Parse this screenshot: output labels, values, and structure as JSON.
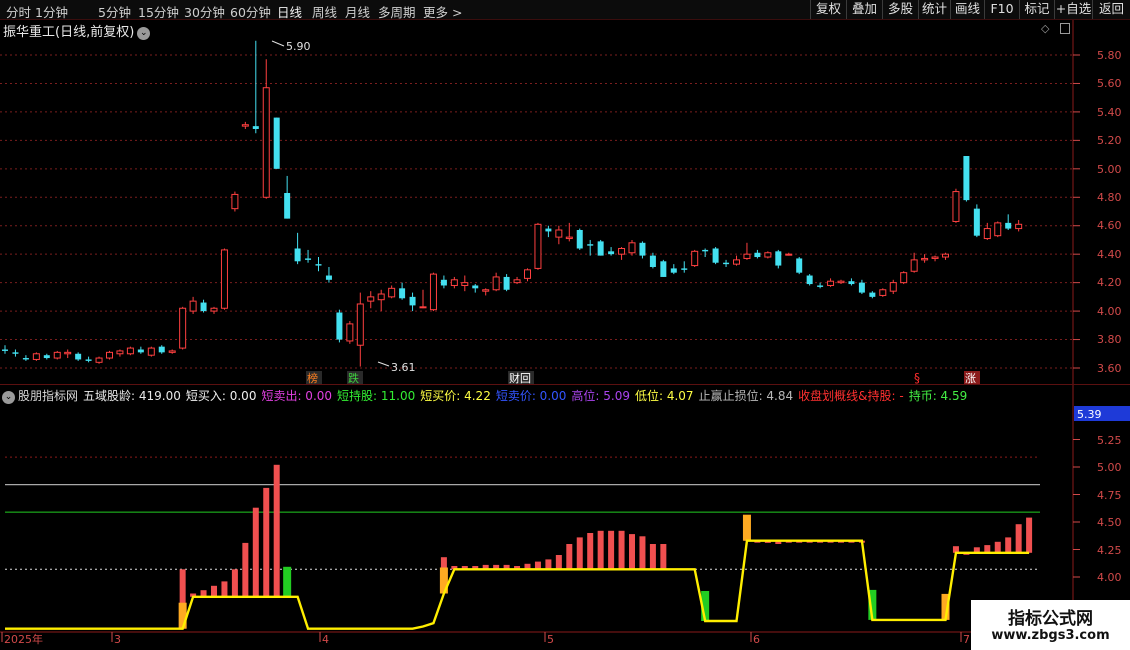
{
  "toolbar": {
    "periods": [
      "分时",
      "1分钟",
      "5分钟",
      "15分钟",
      "30分钟",
      "60分钟",
      "日线",
      "周线",
      "月线",
      "多周期",
      "更多"
    ],
    "more_icon": "chevron-right-icon",
    "right_buttons": [
      "复权",
      "叠加",
      "多股",
      "统计",
      "画线",
      "F10",
      "标记",
      "+自选",
      "返回"
    ]
  },
  "chart_title": "振华重工(日线,前复权)",
  "title_icon": "chevron-down-icon",
  "top_right_icons": [
    "diamond-icon",
    "window-icon"
  ],
  "price_axis": [
    "5.80",
    "5.60",
    "5.40",
    "5.20",
    "5.00",
    "4.80",
    "4.60",
    "4.40",
    "4.20",
    "4.00",
    "3.80",
    "3.60"
  ],
  "annotations": {
    "high": "5.90",
    "low": "3.61"
  },
  "event_markers": [
    {
      "text": "榜",
      "color": "#ff7f1f"
    },
    {
      "text": "跌",
      "color": "#3fd13f"
    },
    {
      "text": "财回",
      "color": "#ffffff"
    },
    {
      "text": "§",
      "color": "#ff2d2d"
    },
    {
      "text": "涨",
      "color": "#ffffff"
    }
  ],
  "indicator_legend": [
    {
      "text": "股朋指标网",
      "color": "#d8d8d8"
    },
    {
      "text": "五域股龄: 419.00",
      "color": "#e8e8e8"
    },
    {
      "text": "短买入: 0.00",
      "color": "#f0f0f0"
    },
    {
      "text": "短卖出: 0.00",
      "color": "#e040e0"
    },
    {
      "text": "短持股: 11.00",
      "color": "#33ee33"
    },
    {
      "text": "短买价: 4.22",
      "color": "#ffff44"
    },
    {
      "text": "短卖价: 0.00",
      "color": "#3355ff"
    },
    {
      "text": "高位: 5.09",
      "color": "#aa44ee"
    },
    {
      "text": "低位: 4.07",
      "color": "#ffff44"
    },
    {
      "text": "止赢止损位: 4.84",
      "color": "#b8b8b8"
    },
    {
      "text": "收盘划概线&持股: -",
      "color": "#ff3030"
    },
    {
      "text": "持币: 4.59",
      "color": "#44ee44"
    }
  ],
  "indicator_axis": [
    "5.25",
    "5.00",
    "4.75",
    "4.50",
    "4.25",
    "4.00"
  ],
  "indicator_current": "5.39",
  "x_axis": [
    "2025年",
    "3",
    "4",
    "5",
    "6",
    "7"
  ],
  "watermark": {
    "line1": "指标公式网",
    "line2": "www.zbgs3.com"
  },
  "colors": {
    "up": "#ff4040",
    "down": "#44e0f0",
    "grid": "#7a1e1e",
    "axis_text": "#d24a4a",
    "signal_line": "#ffee00"
  },
  "chart_data": {
    "type": "candlestick",
    "series": [
      {
        "o": 3.73,
        "h": 3.76,
        "l": 3.7,
        "c": 3.72
      },
      {
        "o": 3.71,
        "h": 3.73,
        "l": 3.68,
        "c": 3.7
      },
      {
        "o": 3.67,
        "h": 3.69,
        "l": 3.65,
        "c": 3.66
      },
      {
        "o": 3.66,
        "h": 3.71,
        "l": 3.65,
        "c": 3.7
      },
      {
        "o": 3.69,
        "h": 3.7,
        "l": 3.66,
        "c": 3.67
      },
      {
        "o": 3.67,
        "h": 3.72,
        "l": 3.66,
        "c": 3.71
      },
      {
        "o": 3.7,
        "h": 3.73,
        "l": 3.67,
        "c": 3.71
      },
      {
        "o": 3.7,
        "h": 3.71,
        "l": 3.65,
        "c": 3.66
      },
      {
        "o": 3.66,
        "h": 3.68,
        "l": 3.64,
        "c": 3.65
      },
      {
        "o": 3.64,
        "h": 3.68,
        "l": 3.63,
        "c": 3.67
      },
      {
        "o": 3.67,
        "h": 3.72,
        "l": 3.66,
        "c": 3.71
      },
      {
        "o": 3.7,
        "h": 3.73,
        "l": 3.68,
        "c": 3.72
      },
      {
        "o": 3.7,
        "h": 3.75,
        "l": 3.69,
        "c": 3.74
      },
      {
        "o": 3.73,
        "h": 3.75,
        "l": 3.7,
        "c": 3.71
      },
      {
        "o": 3.69,
        "h": 3.75,
        "l": 3.68,
        "c": 3.74
      },
      {
        "o": 3.75,
        "h": 3.76,
        "l": 3.7,
        "c": 3.71
      },
      {
        "o": 3.71,
        "h": 3.73,
        "l": 3.7,
        "c": 3.72
      },
      {
        "o": 3.74,
        "h": 4.03,
        "l": 3.73,
        "c": 4.02
      },
      {
        "o": 4.0,
        "h": 4.1,
        "l": 3.98,
        "c": 4.07
      },
      {
        "o": 4.06,
        "h": 4.08,
        "l": 3.99,
        "c": 4.0
      },
      {
        "o": 4.0,
        "h": 4.03,
        "l": 3.98,
        "c": 4.02
      },
      {
        "o": 4.02,
        "h": 4.44,
        "l": 4.01,
        "c": 4.43
      },
      {
        "o": 4.72,
        "h": 4.84,
        "l": 4.7,
        "c": 4.82
      },
      {
        "o": 5.3,
        "h": 5.33,
        "l": 5.28,
        "c": 5.31
      },
      {
        "o": 5.3,
        "h": 5.9,
        "l": 5.25,
        "c": 5.28
      },
      {
        "o": 4.8,
        "h": 5.77,
        "l": 4.79,
        "c": 5.57
      },
      {
        "o": 5.36,
        "h": 5.36,
        "l": 5.0,
        "c": 5.0
      },
      {
        "o": 4.83,
        "h": 4.95,
        "l": 4.65,
        "c": 4.65
      },
      {
        "o": 4.44,
        "h": 4.55,
        "l": 4.33,
        "c": 4.35
      },
      {
        "o": 4.37,
        "h": 4.43,
        "l": 4.34,
        "c": 4.36
      },
      {
        "o": 4.33,
        "h": 4.38,
        "l": 4.28,
        "c": 4.32
      },
      {
        "o": 4.25,
        "h": 4.31,
        "l": 4.2,
        "c": 4.22
      },
      {
        "o": 3.99,
        "h": 4.01,
        "l": 3.78,
        "c": 3.8
      },
      {
        "o": 3.79,
        "h": 3.93,
        "l": 3.77,
        "c": 3.91
      },
      {
        "o": 3.76,
        "h": 4.13,
        "l": 3.61,
        "c": 4.05
      },
      {
        "o": 4.07,
        "h": 4.14,
        "l": 4.02,
        "c": 4.1
      },
      {
        "o": 4.08,
        "h": 4.15,
        "l": 4.0,
        "c": 4.12
      },
      {
        "o": 4.1,
        "h": 4.18,
        "l": 4.09,
        "c": 4.16
      },
      {
        "o": 4.16,
        "h": 4.2,
        "l": 4.08,
        "c": 4.09
      },
      {
        "o": 4.1,
        "h": 4.13,
        "l": 4.0,
        "c": 4.04
      },
      {
        "o": 4.03,
        "h": 4.15,
        "l": 4.02,
        "c": 4.03
      },
      {
        "o": 4.01,
        "h": 4.27,
        "l": 4.0,
        "c": 4.26
      },
      {
        "o": 4.22,
        "h": 4.25,
        "l": 4.16,
        "c": 4.18
      },
      {
        "o": 4.18,
        "h": 4.24,
        "l": 4.16,
        "c": 4.22
      },
      {
        "o": 4.18,
        "h": 4.25,
        "l": 4.14,
        "c": 4.2
      },
      {
        "o": 4.18,
        "h": 4.19,
        "l": 4.13,
        "c": 4.16
      },
      {
        "o": 4.14,
        "h": 4.16,
        "l": 4.11,
        "c": 4.15
      },
      {
        "o": 4.15,
        "h": 4.27,
        "l": 4.14,
        "c": 4.24
      },
      {
        "o": 4.24,
        "h": 4.26,
        "l": 4.14,
        "c": 4.15
      },
      {
        "o": 4.2,
        "h": 4.24,
        "l": 4.19,
        "c": 4.22
      },
      {
        "o": 4.23,
        "h": 4.3,
        "l": 4.21,
        "c": 4.29
      },
      {
        "o": 4.3,
        "h": 4.62,
        "l": 4.29,
        "c": 4.61
      },
      {
        "o": 4.58,
        "h": 4.6,
        "l": 4.52,
        "c": 4.56
      },
      {
        "o": 4.52,
        "h": 4.6,
        "l": 4.47,
        "c": 4.57
      },
      {
        "o": 4.51,
        "h": 4.62,
        "l": 4.49,
        "c": 4.52
      },
      {
        "o": 4.57,
        "h": 4.58,
        "l": 4.43,
        "c": 4.44
      },
      {
        "o": 4.47,
        "h": 4.5,
        "l": 4.39,
        "c": 4.46
      },
      {
        "o": 4.49,
        "h": 4.5,
        "l": 4.39,
        "c": 4.39
      },
      {
        "o": 4.42,
        "h": 4.45,
        "l": 4.39,
        "c": 4.4
      },
      {
        "o": 4.4,
        "h": 4.45,
        "l": 4.36,
        "c": 4.44
      },
      {
        "o": 4.41,
        "h": 4.5,
        "l": 4.39,
        "c": 4.48
      },
      {
        "o": 4.48,
        "h": 4.49,
        "l": 4.37,
        "c": 4.39
      },
      {
        "o": 4.39,
        "h": 4.41,
        "l": 4.3,
        "c": 4.31
      },
      {
        "o": 4.35,
        "h": 4.36,
        "l": 4.24,
        "c": 4.24
      },
      {
        "o": 4.3,
        "h": 4.33,
        "l": 4.26,
        "c": 4.27
      },
      {
        "o": 4.3,
        "h": 4.35,
        "l": 4.27,
        "c": 4.29
      },
      {
        "o": 4.32,
        "h": 4.43,
        "l": 4.31,
        "c": 4.42
      },
      {
        "o": 4.43,
        "h": 4.44,
        "l": 4.38,
        "c": 4.42
      },
      {
        "o": 4.44,
        "h": 4.45,
        "l": 4.33,
        "c": 4.34
      },
      {
        "o": 4.34,
        "h": 4.36,
        "l": 4.31,
        "c": 4.33
      },
      {
        "o": 4.33,
        "h": 4.39,
        "l": 4.32,
        "c": 4.36
      },
      {
        "o": 4.37,
        "h": 4.48,
        "l": 4.36,
        "c": 4.4
      },
      {
        "o": 4.41,
        "h": 4.43,
        "l": 4.37,
        "c": 4.38
      },
      {
        "o": 4.38,
        "h": 4.42,
        "l": 4.37,
        "c": 4.41
      },
      {
        "o": 4.42,
        "h": 4.43,
        "l": 4.3,
        "c": 4.32
      },
      {
        "o": 4.4,
        "h": 4.41,
        "l": 4.39,
        "c": 4.4
      },
      {
        "o": 4.37,
        "h": 4.38,
        "l": 4.26,
        "c": 4.27
      },
      {
        "o": 4.25,
        "h": 4.26,
        "l": 4.18,
        "c": 4.19
      },
      {
        "o": 4.18,
        "h": 4.2,
        "l": 4.16,
        "c": 4.17
      },
      {
        "o": 4.18,
        "h": 4.23,
        "l": 4.17,
        "c": 4.21
      },
      {
        "o": 4.2,
        "h": 4.22,
        "l": 4.19,
        "c": 4.21
      },
      {
        "o": 4.21,
        "h": 4.23,
        "l": 4.18,
        "c": 4.19
      },
      {
        "o": 4.2,
        "h": 4.22,
        "l": 4.12,
        "c": 4.13
      },
      {
        "o": 4.13,
        "h": 4.14,
        "l": 4.09,
        "c": 4.1
      },
      {
        "o": 4.11,
        "h": 4.16,
        "l": 4.1,
        "c": 4.15
      },
      {
        "o": 4.14,
        "h": 4.22,
        "l": 4.12,
        "c": 4.2
      },
      {
        "o": 4.2,
        "h": 4.28,
        "l": 4.19,
        "c": 4.27
      },
      {
        "o": 4.28,
        "h": 4.41,
        "l": 4.27,
        "c": 4.36
      },
      {
        "o": 4.36,
        "h": 4.4,
        "l": 4.34,
        "c": 4.37
      },
      {
        "o": 4.37,
        "h": 4.39,
        "l": 4.35,
        "c": 4.38
      },
      {
        "o": 4.38,
        "h": 4.41,
        "l": 4.36,
        "c": 4.4
      },
      {
        "o": 4.63,
        "h": 4.86,
        "l": 4.62,
        "c": 4.84
      },
      {
        "o": 5.09,
        "h": 5.09,
        "l": 4.77,
        "c": 4.78
      },
      {
        "o": 4.72,
        "h": 4.75,
        "l": 4.52,
        "c": 4.53
      },
      {
        "o": 4.51,
        "h": 4.62,
        "l": 4.5,
        "c": 4.58
      },
      {
        "o": 4.53,
        "h": 4.63,
        "l": 4.52,
        "c": 4.62
      },
      {
        "o": 4.62,
        "h": 4.68,
        "l": 4.57,
        "c": 4.58
      },
      {
        "o": 4.58,
        "h": 4.64,
        "l": 4.56,
        "c": 4.61
      }
    ],
    "indicator": {
      "signal_line": [
        3.53,
        3.53,
        3.53,
        3.53,
        3.53,
        3.53,
        3.53,
        3.53,
        3.53,
        3.53,
        3.53,
        3.53,
        3.53,
        3.53,
        3.53,
        3.53,
        3.53,
        3.53,
        3.82,
        3.82,
        3.82,
        3.82,
        3.82,
        3.82,
        3.82,
        3.82,
        3.82,
        3.82,
        3.82,
        3.53,
        3.53,
        3.53,
        3.53,
        3.53,
        3.53,
        3.53,
        3.53,
        3.53,
        3.53,
        3.53,
        3.55,
        3.58,
        3.85,
        4.07,
        4.07,
        4.07,
        4.07,
        4.07,
        4.07,
        4.07,
        4.07,
        4.07,
        4.07,
        4.07,
        4.07,
        4.07,
        4.07,
        4.07,
        4.07,
        4.07,
        4.07,
        4.07,
        4.07,
        4.07,
        4.07,
        4.07,
        4.07,
        3.6,
        3.6,
        3.6,
        3.6,
        4.33,
        4.33,
        4.33,
        4.33,
        4.33,
        4.33,
        4.33,
        4.33,
        4.33,
        4.33,
        4.33,
        4.33,
        3.61,
        3.61,
        3.61,
        3.61,
        3.61,
        3.61,
        3.61,
        3.61,
        4.22,
        4.22,
        4.22,
        4.22,
        4.22,
        4.22,
        4.22,
        4.22
      ],
      "bars": [
        0,
        0,
        0,
        0,
        0,
        0,
        0,
        0,
        0,
        0,
        0,
        0,
        0,
        0,
        0,
        0,
        0,
        4.07,
        3.85,
        3.88,
        3.92,
        3.96,
        4.07,
        4.31,
        4.63,
        4.81,
        5.02,
        0,
        0,
        0,
        0,
        0,
        0,
        0,
        0,
        0,
        0,
        0,
        0,
        0,
        0,
        0,
        4.18,
        4.1,
        4.1,
        4.1,
        4.11,
        4.11,
        4.11,
        4.1,
        4.12,
        4.14,
        4.16,
        4.2,
        4.3,
        4.36,
        4.4,
        4.42,
        4.42,
        4.42,
        4.39,
        4.37,
        4.3,
        4.3,
        0,
        0,
        0,
        0,
        0,
        0,
        0,
        4.39,
        4.32,
        4.31,
        4.3,
        4.33,
        4.33,
        4.33,
        4.33,
        4.33,
        4.33,
        4.33,
        4.33,
        0,
        0,
        0,
        0,
        0,
        0,
        0,
        0,
        4.28,
        4.22,
        4.27,
        4.29,
        4.32,
        4.36,
        4.48,
        4.54,
        4.51,
        4.53,
        4.55,
        4.55
      ],
      "buy_markers": [
        17,
        42,
        71,
        90
      ],
      "sell_markers": [
        27,
        67,
        83
      ],
      "levels": {
        "stop": 4.84,
        "long": 4.59,
        "reference": 4.07,
        "upper": 5.09
      }
    }
  }
}
